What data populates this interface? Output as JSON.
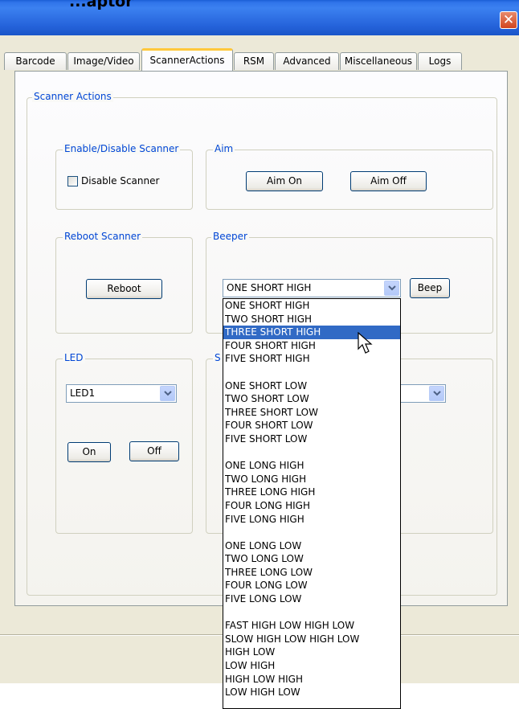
{
  "window": {
    "title": "...aptor"
  },
  "tabs": [
    "Barcode",
    "Image/Video",
    "ScannerActions",
    "RSM",
    "Advanced",
    "Miscellaneous",
    "Logs"
  ],
  "active_tab": "ScannerActions",
  "scanner_actions": {
    "legend": "Scanner Actions",
    "enable_disable": {
      "legend": "Enable/Disable Scanner",
      "checkbox_label": "Disable Scanner",
      "checked": false
    },
    "aim": {
      "legend": "Aim",
      "on": "Aim On",
      "off": "Aim Off"
    },
    "reboot": {
      "legend": "Reboot Scanner",
      "button": "Reboot"
    },
    "beeper": {
      "legend": "Beeper",
      "selected": "ONE SHORT HIGH",
      "button": "Beep"
    },
    "led": {
      "legend": "LED",
      "selected": "LED1",
      "on": "On",
      "off": "Off"
    },
    "hidden_group": {
      "legend": "S"
    }
  },
  "beeper_options": [
    "ONE SHORT HIGH",
    "TWO SHORT HIGH",
    "THREE SHORT HIGH",
    "FOUR SHORT HIGH",
    "FIVE SHORT HIGH",
    "",
    "ONE SHORT LOW",
    "TWO SHORT LOW",
    "THREE SHORT LOW",
    "FOUR SHORT LOW",
    "FIVE SHORT LOW",
    "",
    "ONE LONG HIGH",
    "TWO LONG HIGH",
    "THREE LONG HIGH",
    "FOUR LONG HIGH",
    "FIVE LONG HIGH",
    "",
    "ONE LONG LOW",
    "TWO LONG LOW",
    "THREE LONG LOW",
    "FOUR LONG LOW",
    "FIVE LONG LOW",
    "",
    "FAST HIGH LOW HIGH LOW",
    "SLOW HIGH LOW HIGH LOW",
    "HIGH LOW",
    "LOW HIGH",
    "HIGH LOW HIGH",
    "LOW HIGH LOW"
  ],
  "highlighted_option": "THREE SHORT HIGH",
  "icons": {
    "close": "close-icon",
    "arrow": "chevron-down-icon",
    "cursor": "mouse-pointer-icon"
  }
}
